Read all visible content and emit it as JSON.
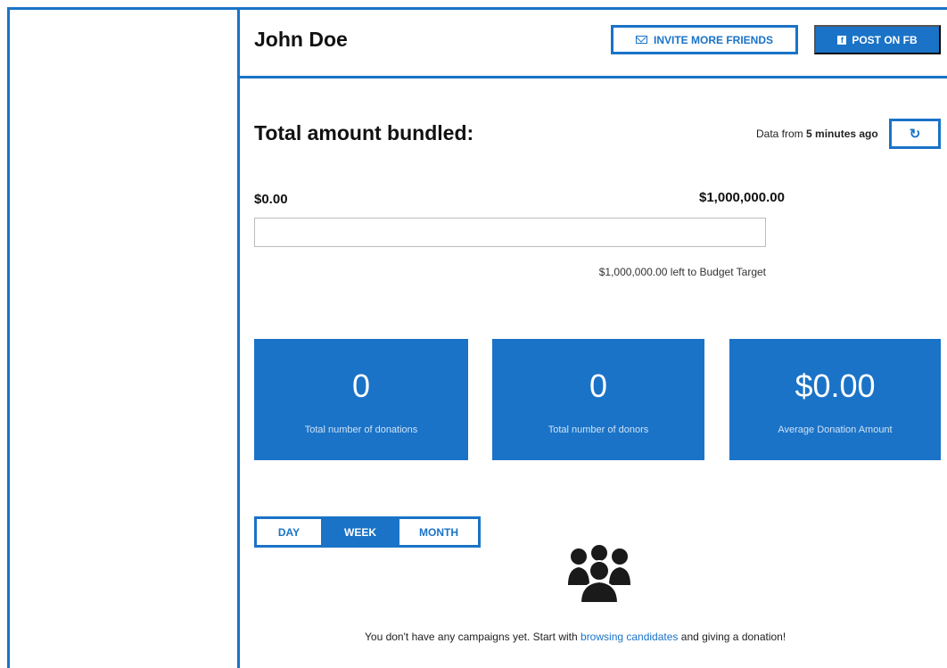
{
  "header": {
    "user_name": "John Doe",
    "invite_label": "INVITE MORE FRIENDS",
    "fb_label": "POST ON FB"
  },
  "bundled": {
    "title": "Total amount bundled:",
    "data_from_prefix": "Data from",
    "data_from_age": "5 minutes ago",
    "range_min": "$0.00",
    "range_max": "$1,000,000.00",
    "progress_fraction": 0,
    "left_to_budget": "$1,000,000.00 left to Budget Target"
  },
  "stats": [
    {
      "value": "0",
      "label": "Total number of donations"
    },
    {
      "value": "0",
      "label": "Total number of donors"
    },
    {
      "value": "$0.00",
      "label": "Average Donation Amount"
    }
  ],
  "periods": {
    "day": "DAY",
    "week": "WEEK",
    "month": "MONTH",
    "selected": "WEEK"
  },
  "empty_state": {
    "message_prefix": "You don't have any campaigns yet. Start with",
    "link_text": "browsing candidates",
    "message_suffix": "and giving a donation!"
  },
  "colors": {
    "accent": "#1a73c7"
  },
  "icons": {
    "invite": "mail-icon",
    "fb": "facebook-icon",
    "refresh": "refresh-icon",
    "empty": "group-icon"
  }
}
